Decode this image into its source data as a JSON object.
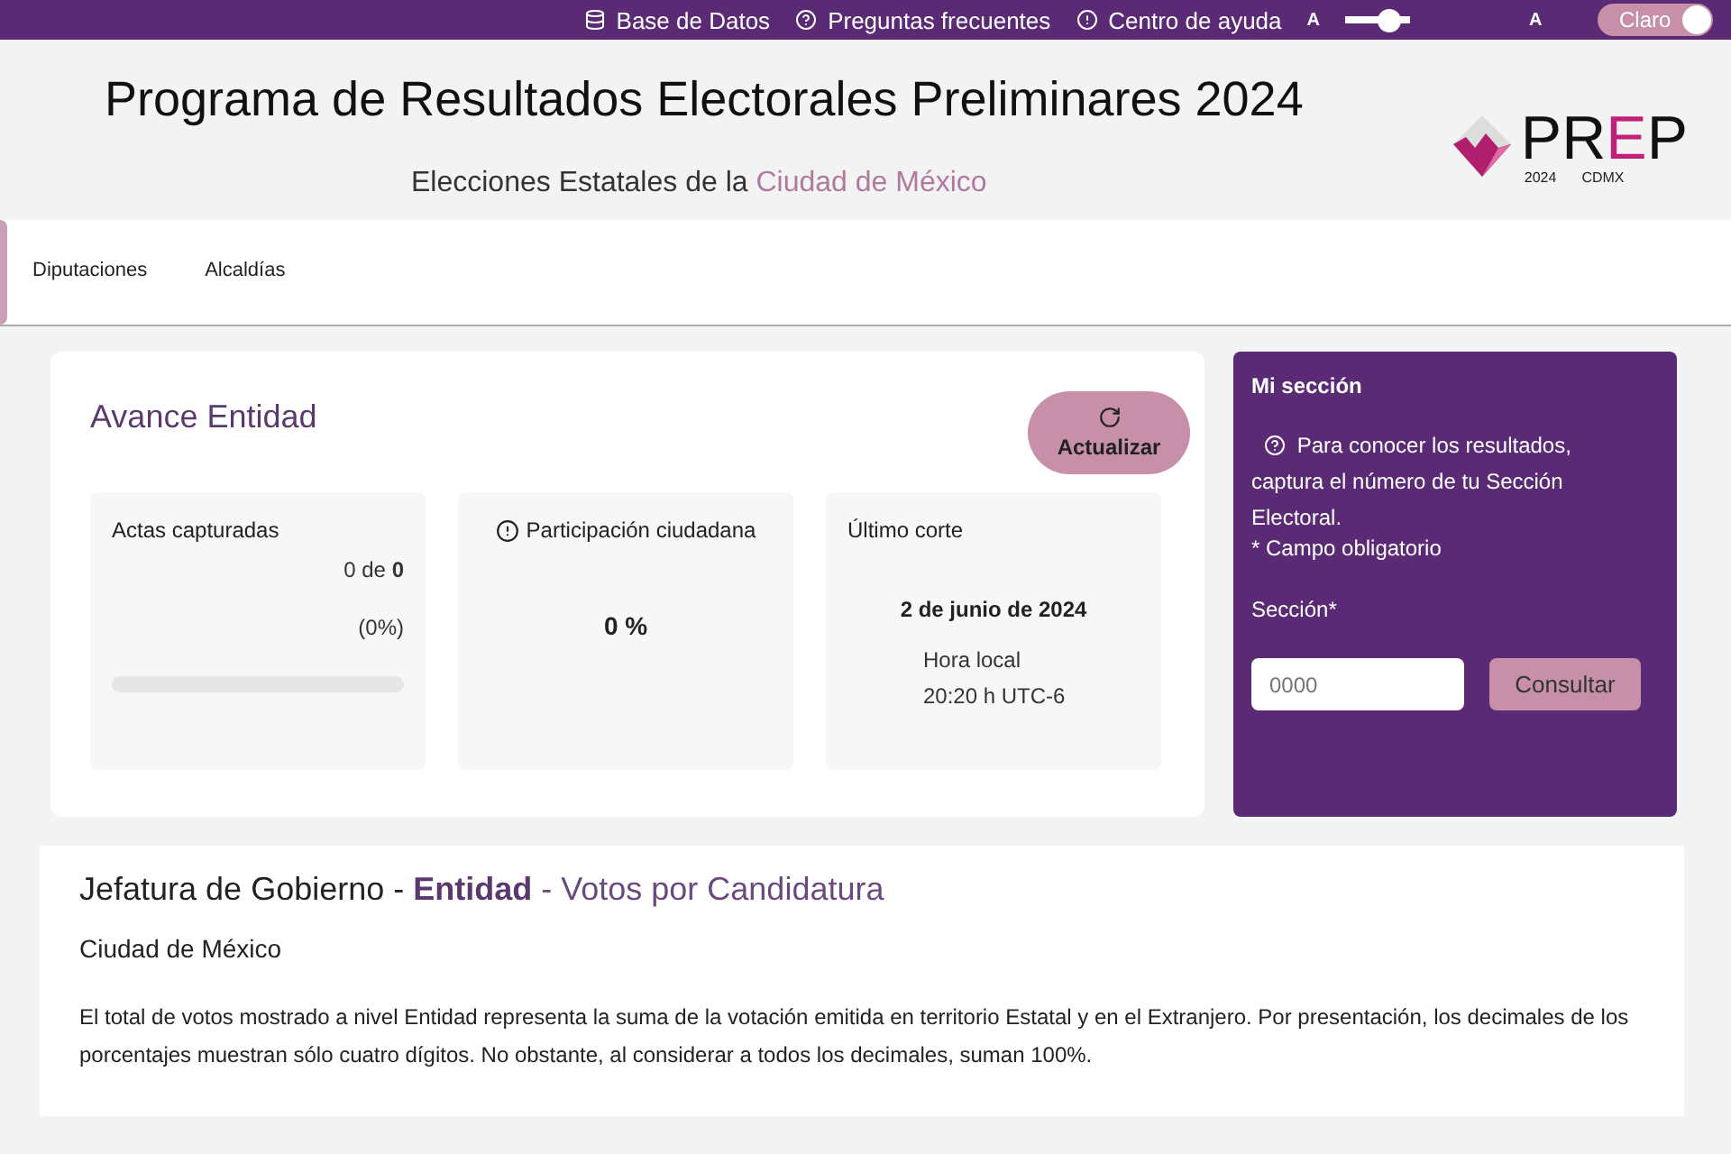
{
  "top_bar": {
    "links": [
      {
        "kind": "database",
        "label": "Base de Datos"
      },
      {
        "kind": "question",
        "label": "Preguntas frecuentes"
      },
      {
        "kind": "info",
        "label": "Centro de ayuda"
      }
    ],
    "font_size": {
      "small_label": "A",
      "large_label": "A",
      "level": 0.8
    },
    "theme_toggle": {
      "label": "Claro",
      "on": true
    }
  },
  "header": {
    "title": "Programa de Resultados Electorales Preliminares 2024",
    "subtitle": "Elecciones Estatales de la",
    "subtitle_highlight": "Ciudad de México",
    "logo": {
      "word_main": "PR",
      "word_accent": "E",
      "word_end": "P",
      "year": "2024",
      "region": "CDMX"
    }
  },
  "tabs": [
    {
      "label": "Diputaciones",
      "selected": false
    },
    {
      "label": "Alcaldías",
      "selected": false
    }
  ],
  "progress": {
    "title": "Avance Entidad",
    "refresh_button": "Actualizar",
    "cards": [
      {
        "kind": "actas",
        "title": "Actas capturadas",
        "count": "0 de **0**",
        "percent": "(0%)"
      },
      {
        "kind": "participation",
        "title": "Participación ciudadana",
        "value": "0 %"
      },
      {
        "kind": "cut",
        "title": "Último corte",
        "date": "2 de junio de 2024",
        "time_label": "Hora local",
        "time": "20:20 h UTC-6"
      }
    ]
  },
  "my_section": {
    "title": "Mi sección",
    "help": "Para conocer los resultados,",
    "help_rest": "captura el número de tu Sección Electoral.",
    "required_note": "* Campo obligatorio",
    "field_label": "Sección*",
    "placeholder": "0000",
    "button": "Consultar"
  },
  "results": {
    "heading_prefix": "Jefatura de Gobierno - ",
    "heading_highlight": "Entidad",
    "heading_suffix": " - Votos por Candidatura",
    "place": "Ciudad de México",
    "note": "El total de votos mostrado a nivel Entidad representa la suma de la votación emitida en territorio Estatal y en el Extranjero. Por presentación, los decimales de los porcentajes muestran sólo cuatro dígitos. No obstante, al considerar a todos los decimales, suman 100%."
  }
}
